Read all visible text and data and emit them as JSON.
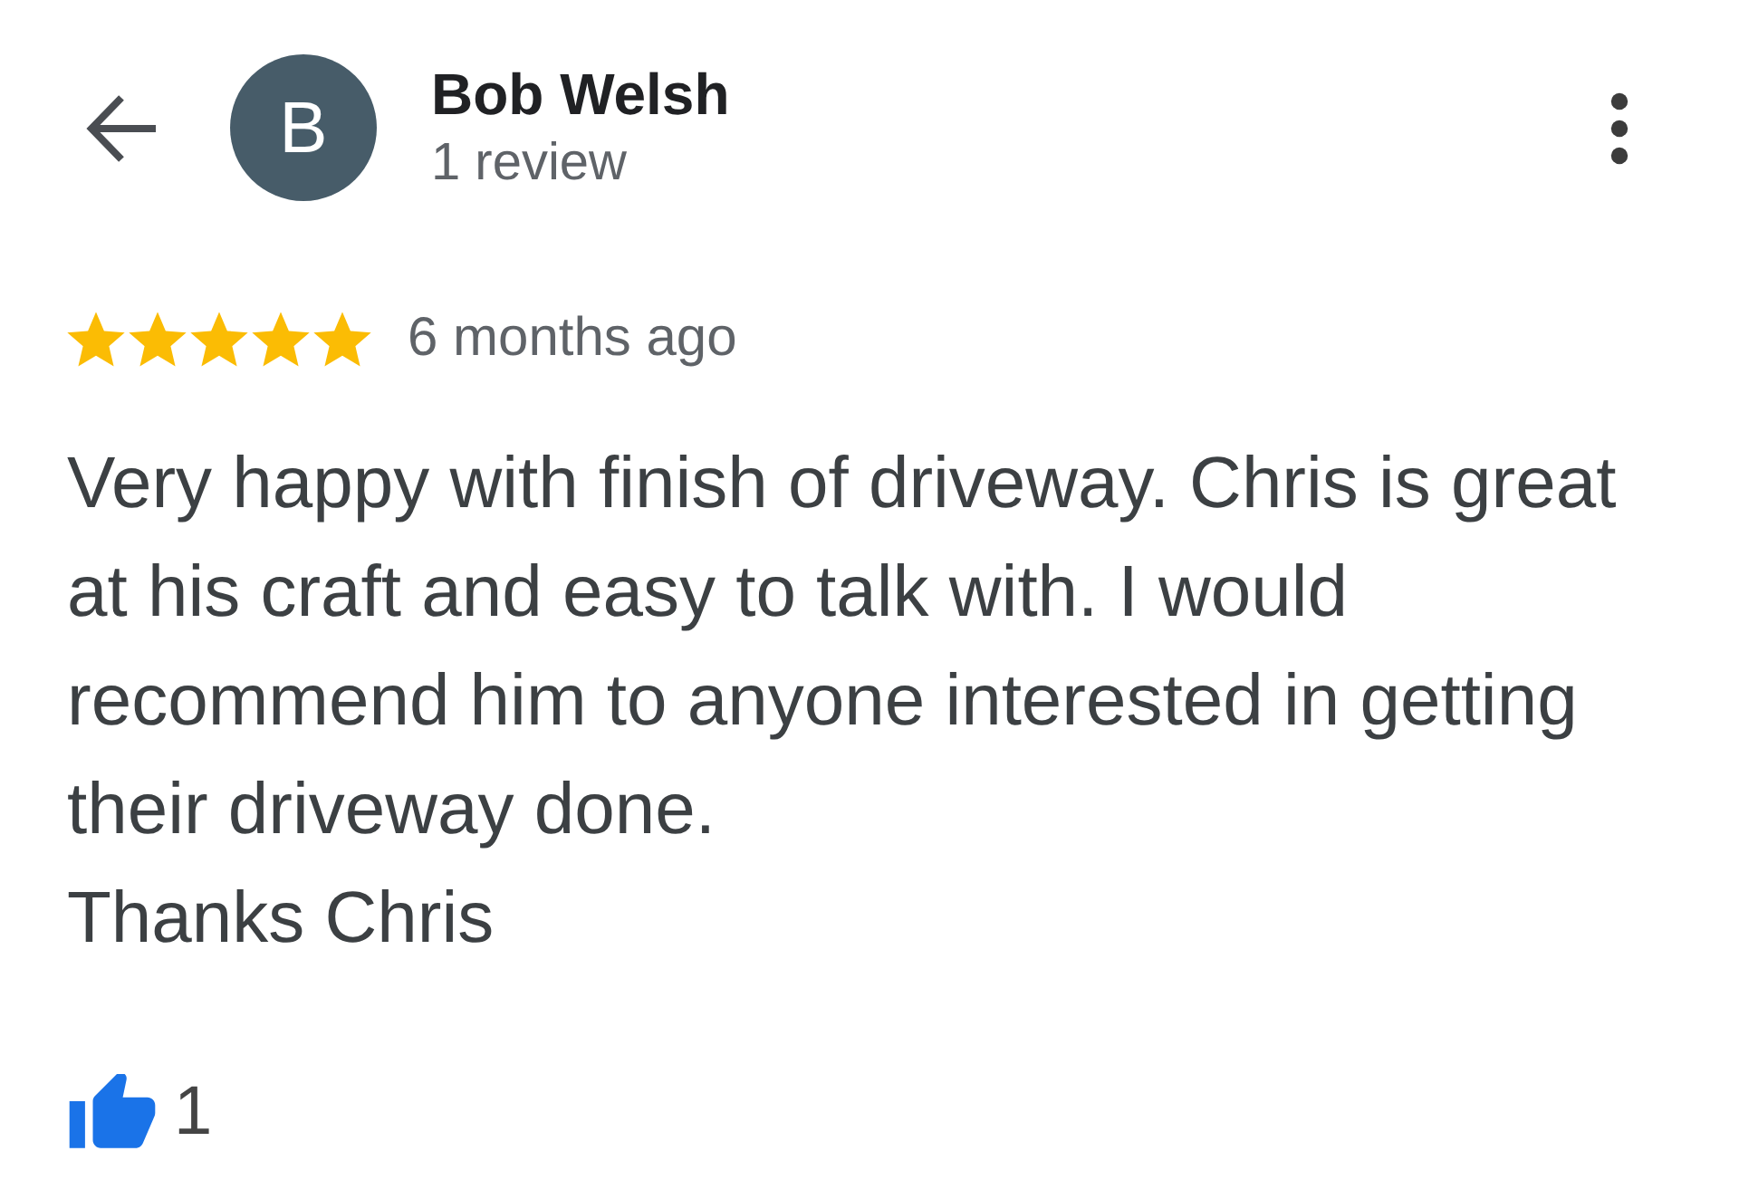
{
  "header": {
    "avatar_letter": "B",
    "name": "Bob Welsh",
    "subtitle": "1 review"
  },
  "review": {
    "stars": 5,
    "time": "6 months ago",
    "text": "Very happy with finish of driveway. Chris is great at his craft and easy to talk with. I would recommend him to anyone interested in getting their driveway done.\nThanks Chris"
  },
  "likes": {
    "liked": true,
    "count": "1"
  }
}
